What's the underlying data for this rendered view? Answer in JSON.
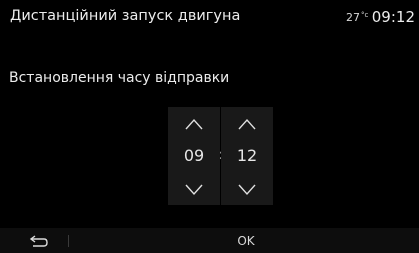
{
  "header": {
    "title": "Дистанційний запуск двигуна",
    "temperature": "27",
    "temperature_unit": "°c",
    "clock": "09:12"
  },
  "subtitle": "Встановлення часу відправки",
  "picker": {
    "hours": "09",
    "separator": ":",
    "minutes": "12",
    "up_icon": "chevron-up-icon",
    "down_icon": "chevron-down-icon"
  },
  "bottom_bar": {
    "back_icon": "back-arrow-icon",
    "ok_label": "OK"
  },
  "colors": {
    "background": "#000000",
    "picker_column": "#191919",
    "text": "#ececec"
  }
}
